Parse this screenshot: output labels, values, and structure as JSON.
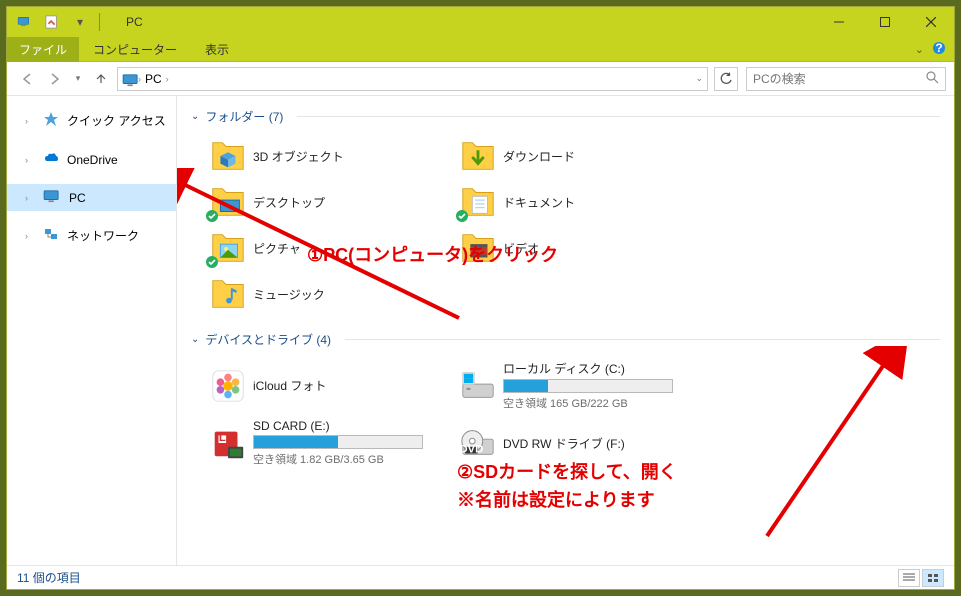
{
  "title": "PC",
  "ribbon": {
    "file": "ファイル",
    "computer": "コンピューター",
    "view": "表示"
  },
  "breadcrumb": {
    "root": "PC"
  },
  "search": {
    "placeholder": "PCの検索"
  },
  "sidebar": {
    "items": [
      {
        "label": "クイック アクセス"
      },
      {
        "label": "OneDrive"
      },
      {
        "label": "PC"
      },
      {
        "label": "ネットワーク"
      }
    ]
  },
  "groups": {
    "folders": {
      "header": "フォルダー (7)"
    },
    "devices": {
      "header": "デバイスとドライブ (4)"
    }
  },
  "folders": [
    {
      "name": "3D オブジェクト"
    },
    {
      "name": "ダウンロード"
    },
    {
      "name": "デスクトップ"
    },
    {
      "name": "ドキュメント"
    },
    {
      "name": "ピクチャ"
    },
    {
      "name": "ビデオ"
    },
    {
      "name": "ミュージック"
    }
  ],
  "drives": [
    {
      "name": "iCloud フォト",
      "type": "icloud"
    },
    {
      "name": "ローカル ディスク (C:)",
      "type": "disk",
      "free_text": "空き領域 165 GB/222 GB",
      "usage_pct": 26
    },
    {
      "name": "SD CARD (E:)",
      "type": "sd",
      "free_text": "空き領域 1.82 GB/3.65 GB",
      "usage_pct": 50
    },
    {
      "name": "DVD RW ドライブ (F:)",
      "type": "dvd"
    }
  ],
  "statusbar": {
    "count": "11 個の項目"
  },
  "annotations": {
    "a1": "①PC(コンピュータ)をクリック",
    "a2": "②SDカードを探して、開く",
    "a2b": "※名前は設定によります"
  }
}
